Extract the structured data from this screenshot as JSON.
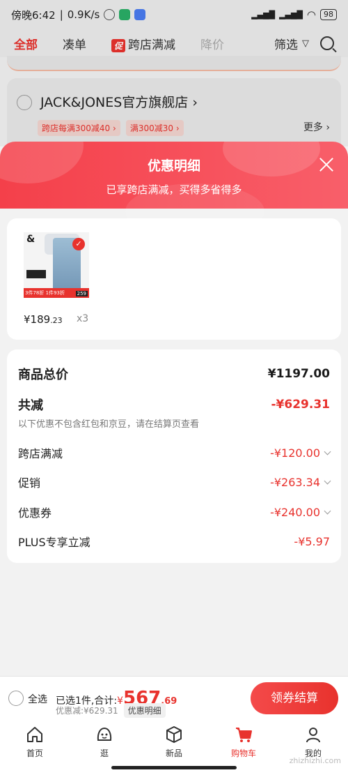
{
  "status_bar": {
    "time": "傍晚6:42",
    "network_speed": "0.9K/s",
    "battery": "98"
  },
  "top_nav": {
    "tabs": [
      "全部",
      "凑单",
      "跨店满减",
      "降价"
    ],
    "promo_tag": "促",
    "filter_label": "筛选"
  },
  "background_store": {
    "name": "JACK&JONES官方旗舰店",
    "chips": [
      "跨店每满300减40",
      "满300减30"
    ],
    "more_label": "更多"
  },
  "sheet": {
    "title": "优惠明细",
    "subtitle": "已享跨店满减，买得多省得多",
    "product": {
      "price_main": "¥189",
      "price_decimal": ".23",
      "quantity": "x3",
      "thumb_labels": [
        "&",
        "259",
        "3件78折",
        "1件93折"
      ]
    },
    "summary": {
      "total_label": "商品总价",
      "total_value": "¥1197.00",
      "reduce_label": "共减",
      "reduce_value": "-¥629.31",
      "note": "以下优惠不包含红包和京豆，请在结算页查看",
      "items": [
        {
          "label": "跨店满减",
          "value": "-¥120.00"
        },
        {
          "label": "促销",
          "value": "-¥263.34"
        },
        {
          "label": "优惠券",
          "value": "-¥240.00"
        },
        {
          "label": "PLUS专享立减",
          "value": "-¥5.97"
        }
      ]
    }
  },
  "checkout": {
    "select_all": "全选",
    "selected_text": "已选1件,合计:",
    "currency": "¥",
    "total_int": "567",
    "total_dec": ".69",
    "discount_text": "优惠减:¥629.31",
    "detail_label": "优惠明细",
    "pay_button": "领券结算"
  },
  "bottom_nav": {
    "items": [
      "首页",
      "逛",
      "新品",
      "购物车",
      "我的"
    ]
  },
  "watermark": "zhizhizhi.com",
  "colors": {
    "accent": "#e8322d",
    "header_gradient_start": "#f4404a",
    "header_gradient_end": "#f85f6a"
  }
}
